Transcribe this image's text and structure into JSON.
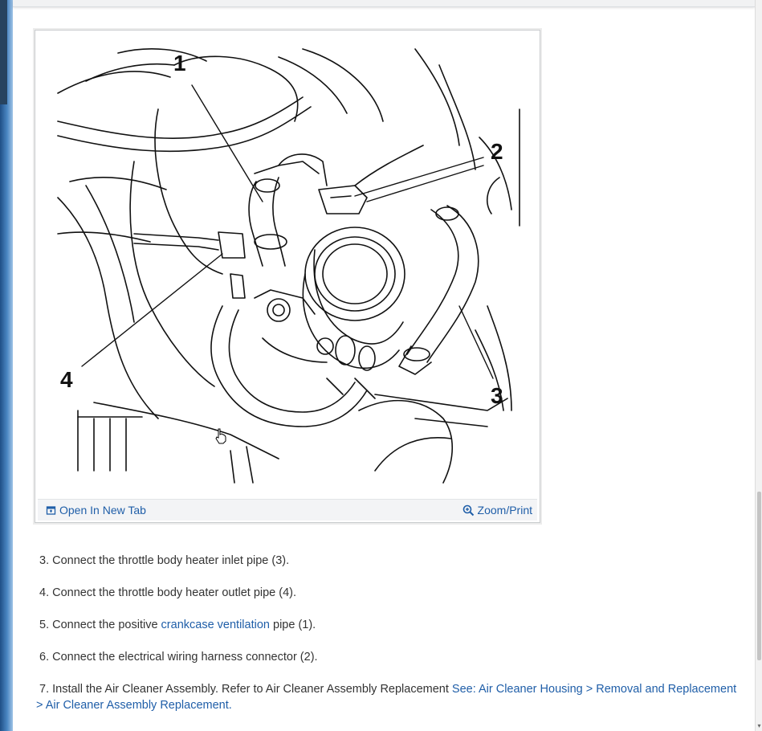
{
  "figure": {
    "callouts": [
      "1",
      "2",
      "3",
      "4"
    ],
    "open_label": "Open In New Tab",
    "zoom_label": "Zoom/Print",
    "open_icon": "open-in-new-tab-icon",
    "zoom_icon": "magnifier-plus-icon"
  },
  "steps": [
    {
      "num": "3.",
      "text": "Connect the throttle body heater inlet pipe (3)."
    },
    {
      "num": "4.",
      "text": "Connect the throttle body heater outlet pipe (4)."
    },
    {
      "num": "5.",
      "pre": "Connect the positive",
      "link": "crankcase ventilation",
      "post": "pipe (1)."
    },
    {
      "num": "6.",
      "text": "Connect the electrical wiring harness connector (2)."
    },
    {
      "num": "7.",
      "pre": "Install the Air Cleaner Assembly. Refer to Air Cleaner Assembly Replacement",
      "link": "See: Air Cleaner Housing > Removal and Replacement > Air Cleaner Assembly Replacement."
    }
  ],
  "colors": {
    "link": "#1f5ea8",
    "text": "#333333",
    "desktop": "#3a6fa8"
  }
}
